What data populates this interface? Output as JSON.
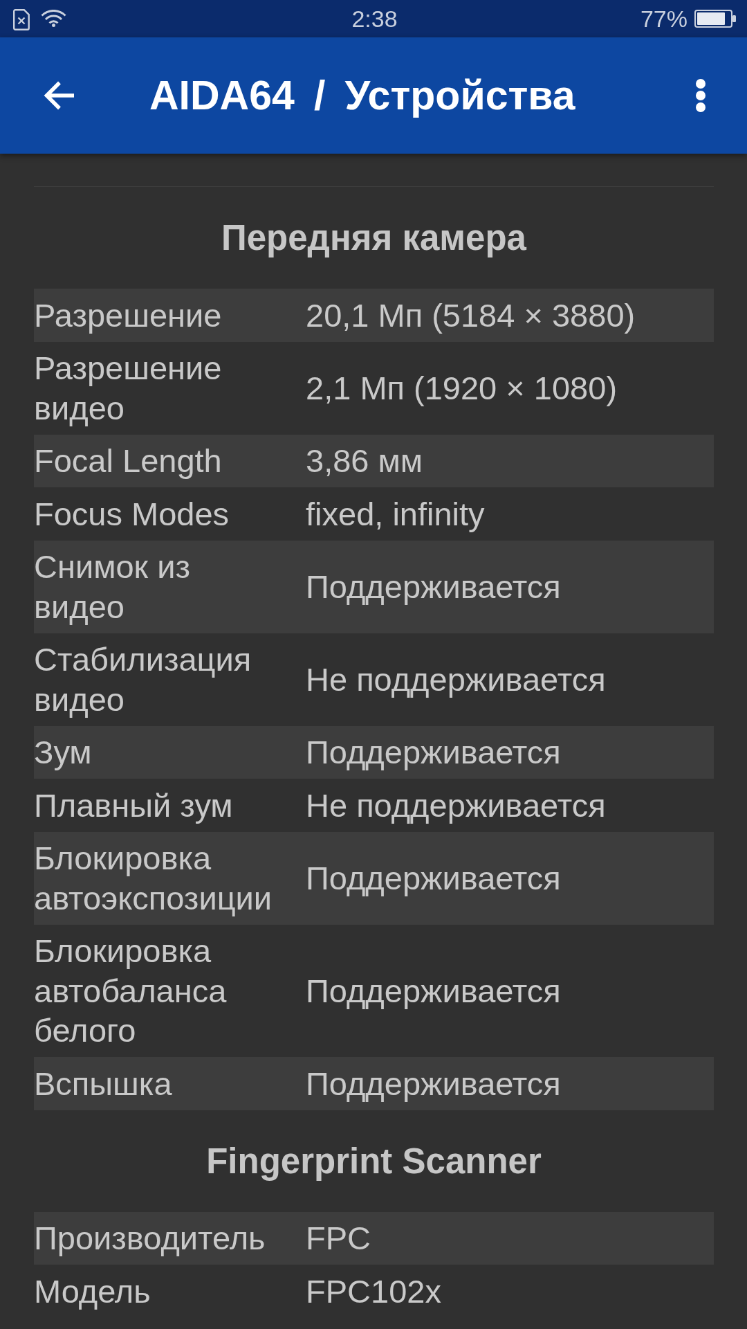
{
  "status_bar": {
    "time": "2:38",
    "battery": "77%"
  },
  "app_bar": {
    "title": "AIDA64 / Устройства"
  },
  "sections": [
    {
      "title": "Передняя камера",
      "rows": [
        {
          "label": "Разрешение",
          "value": "20,1 Мп (5184 × 3880)"
        },
        {
          "label": "Разрешение видео",
          "value": "2,1 Мп (1920 × 1080)"
        },
        {
          "label": "Focal Length",
          "value": "3,86 мм"
        },
        {
          "label": "Focus Modes",
          "value": "fixed, infinity"
        },
        {
          "label": "Снимок из видео",
          "value": "Поддерживается"
        },
        {
          "label": "Стабилизация видео",
          "value": "Не поддерживается"
        },
        {
          "label": "Зум",
          "value": "Поддерживается"
        },
        {
          "label": "Плавный зум",
          "value": "Не поддерживается"
        },
        {
          "label": "Блокировка автоэкспозиции",
          "value": "Поддерживается"
        },
        {
          "label": "Блокировка автобаланса белого",
          "value": "Поддерживается"
        },
        {
          "label": "Вспышка",
          "value": "Поддерживается"
        }
      ]
    },
    {
      "title": "Fingerprint Scanner",
      "rows": [
        {
          "label": "Производитель",
          "value": "FPC"
        },
        {
          "label": "Модель",
          "value": "FPC102x"
        }
      ]
    }
  ]
}
